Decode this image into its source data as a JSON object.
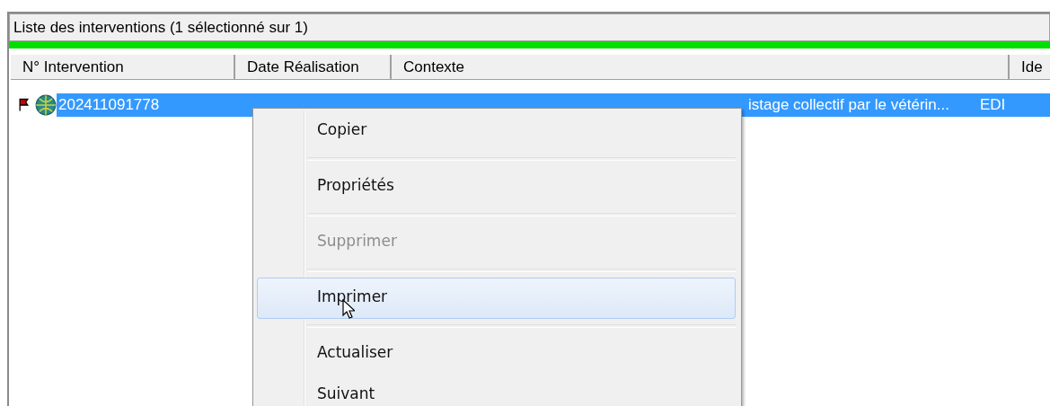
{
  "panel": {
    "title": "Liste des interventions  (1 sélectionné sur 1)"
  },
  "table": {
    "columns": [
      "N° Intervention",
      "Date Réalisation",
      "Contexte",
      "Ide"
    ],
    "rows": [
      {
        "selected": true,
        "cells": [
          "202411091778",
          "",
          "istage collectif par le vétérin...",
          "EDI"
        ]
      }
    ]
  },
  "context_menu": {
    "items": [
      {
        "kind": "item",
        "label": "Copier",
        "disabled": false,
        "selected": false
      },
      {
        "kind": "separator"
      },
      {
        "kind": "item",
        "label": "Propriétés",
        "disabled": false,
        "selected": false
      },
      {
        "kind": "separator"
      },
      {
        "kind": "item",
        "label": "Supprimer",
        "disabled": true,
        "selected": false
      },
      {
        "kind": "separator"
      },
      {
        "kind": "item",
        "label": "Imprimer",
        "disabled": false,
        "selected": true
      },
      {
        "kind": "separator"
      },
      {
        "kind": "item",
        "label": "Actualiser",
        "disabled": false,
        "selected": false
      },
      {
        "kind": "item",
        "label": "Suivant",
        "disabled": false,
        "selected": false
      }
    ]
  }
}
